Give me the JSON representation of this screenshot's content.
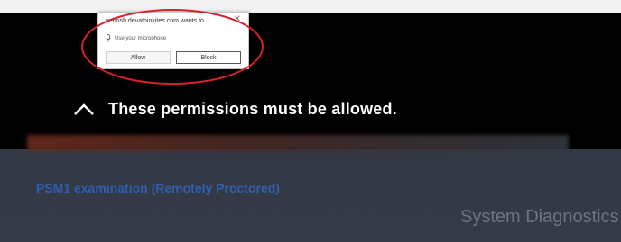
{
  "permission_prompt": {
    "origin_text": "nebosh.devathinkites.com wants to",
    "permission_text": "Use your microphone",
    "allow_label": "Allow",
    "block_label": "Block",
    "close_glyph": "✕",
    "mic_icon": "microphone-icon"
  },
  "overlay": {
    "message": "These permissions must be allowed.",
    "chevron_icon": "chevron-up-icon"
  },
  "page": {
    "exam_title": "PSM1 examination (Remotely Proctored)",
    "diagnostics_title": "System Diagnostics"
  },
  "colors": {
    "overlay": "#000000",
    "page_background": "#333845",
    "exam_title": "#2f5fae",
    "annotation": "#d6202a"
  }
}
